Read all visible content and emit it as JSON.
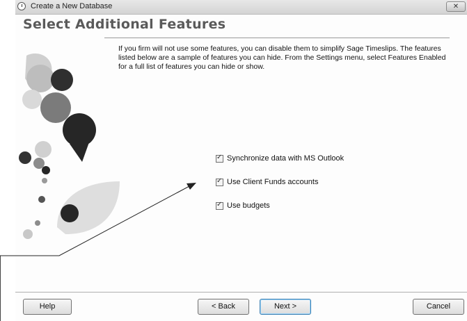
{
  "window": {
    "title": "Create a New Database",
    "close_glyph": "✕"
  },
  "page": {
    "title": "Select Additional Features",
    "description": "If you firm will not use some features, you can disable them to simplify Sage Timeslips. The features listed below are a sample of features you can hide. From the Settings menu, select Features Enabled for a full list of features you can hide or show."
  },
  "features": [
    {
      "label": "Synchronize data with MS Outlook",
      "checked": true
    },
    {
      "label": "Use Client Funds accounts",
      "checked": true
    },
    {
      "label": "Use budgets",
      "checked": true
    }
  ],
  "buttons": {
    "help": {
      "label": "Help"
    },
    "back": {
      "label": "< Back"
    },
    "next": {
      "label": "Next >"
    },
    "cancel": {
      "label": "Cancel"
    }
  },
  "colors": {
    "accent_dark": "#333333",
    "accent_mid": "#7a7a7a",
    "accent_light": "#c4c4c4"
  }
}
